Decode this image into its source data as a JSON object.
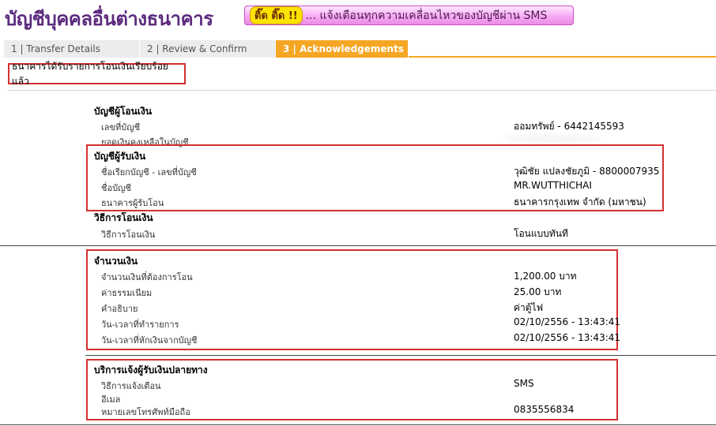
{
  "header": {
    "title": "บัญชีบุคคลอื่นต่างธนาคาร",
    "banner_badge": "ติ๊ด ติ๊ด !!",
    "banner_text": "... แจ้งเตือนทุกความเคลื่อนไหวของบัญชีผ่าน SMS"
  },
  "tabs": [
    {
      "label": "1 | Transfer Details"
    },
    {
      "label": "2 | Review & Confirm"
    },
    {
      "label": "3 | Acknowledgements"
    }
  ],
  "notice": "ธนาคารได้รับรายการโอนเงินเรียบร้อยแล้ว",
  "from_account": {
    "title": "บัญชีผู้โอนเงิน",
    "rows": [
      {
        "label": "เลขที่บัญชี",
        "value": "ออมทรัพย์ - 6442145593"
      },
      {
        "label": "ยอดเงินคงเหลือในบัญชี",
        "value": ""
      }
    ]
  },
  "to_account": {
    "title": "บัญชีผู้รับเงิน",
    "rows": [
      {
        "label": "ชื่อเรียกบัญชี - เลขที่บัญชี",
        "value": "วุฒิชัย แปลงชัยภูมิ - 8800007935"
      },
      {
        "label": "ชื่อบัญชี",
        "value": "MR.WUTTHICHAI"
      },
      {
        "label": "ธนาคารผู้รับโอน",
        "value": "ธนาคารกรุงเทพ จำกัด (มหาชน)"
      }
    ]
  },
  "method": {
    "title": "วิธีการโอนเงิน",
    "rows": [
      {
        "label": "วิธีการโอนเงิน",
        "value": "โอนแบบทันที"
      }
    ]
  },
  "amount": {
    "title": "จำนวนเงิน",
    "rows": [
      {
        "label": "จำนวนเงินที่ต้องการโอน",
        "value": "1,200.00 บาท"
      },
      {
        "label": "ค่าธรรมเนียม",
        "value": "25.00  บาท"
      },
      {
        "label": "คำอธิบาย",
        "value": "ค่าตู้ไฟ"
      },
      {
        "label": "วัน-เวลาที่ทำรายการ",
        "value": "02/10/2556 - 13:43:41"
      },
      {
        "label": "วัน-เวลาที่หักเงินจากบัญชี",
        "value": "02/10/2556 - 13:43:41"
      }
    ]
  },
  "notify": {
    "title": "บริการแจ้งผู้รับเงินปลายทาง",
    "rows": [
      {
        "label": "วิธีการแจ้งเตือน",
        "value": "SMS"
      },
      {
        "label": "อีเมล",
        "value": ""
      },
      {
        "label": "หมายเลขโทรศัพท์มือถือ",
        "value": "0835556834"
      }
    ]
  },
  "colors": {
    "title": "#5b2a7e",
    "accent_tab": "#f5a623",
    "highlight_box": "#d43030",
    "banner": "#f6a6f2"
  }
}
